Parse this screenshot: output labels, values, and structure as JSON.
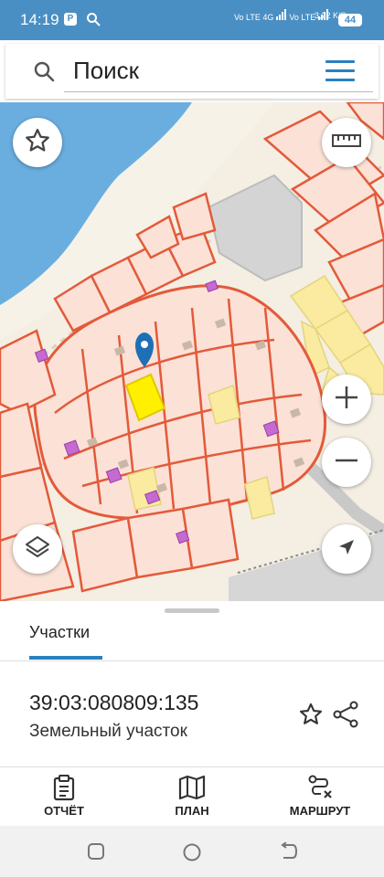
{
  "status_bar": {
    "time": "14:19",
    "app_badge": "P",
    "network_label_1": "Vo LTE",
    "network_label_2": "4G",
    "network_label_3": "Vo LTE",
    "speed": "3,22 K/S",
    "battery": "44"
  },
  "search": {
    "placeholder": "Поиск",
    "icon": "search-icon",
    "menu_icon": "menu-icon"
  },
  "map": {
    "icons": [
      "star-icon",
      "ruler-icon",
      "layers-icon",
      "plus-icon",
      "minus-icon",
      "navigation-arrow-icon",
      "location-pin-icon"
    ],
    "colors": {
      "water": "#6aaee0",
      "parcel_fill": "#fbe1d6",
      "parcel_border": "#e35a3a",
      "selected_parcel": "#fff000",
      "yellow_parcel": "#fbeba0",
      "building": "#c46ad0",
      "pin": "#1f6fb5"
    }
  },
  "tabs": {
    "active": "Участки"
  },
  "parcel": {
    "cadastral_number": "39:03:080809:135",
    "type": "Земельный участок"
  },
  "bottom_nav": {
    "items": [
      {
        "label": "ОТЧЁТ",
        "icon": "report-icon"
      },
      {
        "label": "ПЛАН",
        "icon": "map-plan-icon"
      },
      {
        "label": "МАРШРУТ",
        "icon": "route-icon"
      }
    ]
  },
  "system_nav": {
    "icons": [
      "recents-icon",
      "home-icon",
      "back-icon"
    ]
  },
  "accent_color": "#2b7fc0",
  "status_bar_color": "#4a8fc4"
}
